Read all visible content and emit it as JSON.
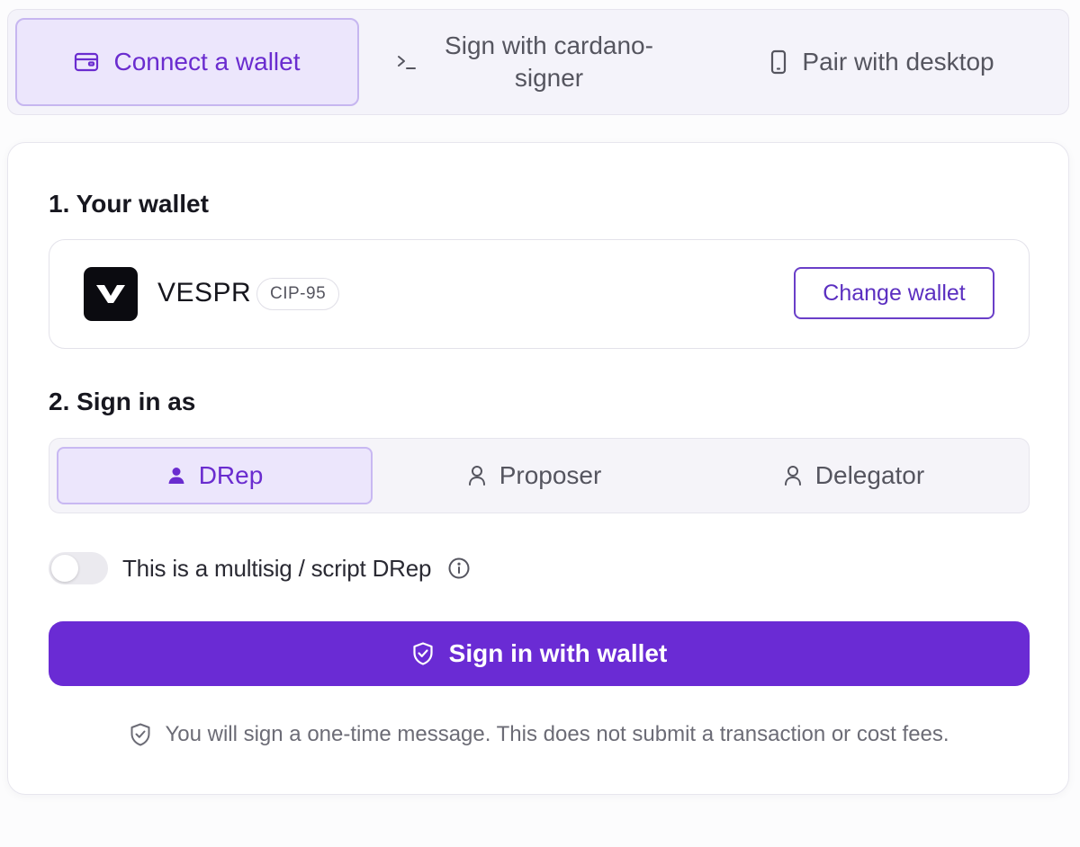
{
  "method_tabs": [
    {
      "label": "Connect a wallet",
      "icon": "wallet-icon",
      "active": true
    },
    {
      "label": "Sign with cardano-signer",
      "icon": "terminal-icon",
      "active": false
    },
    {
      "label": "Pair with desktop",
      "icon": "smartphone-icon",
      "active": false
    }
  ],
  "wallet_section": {
    "title": "1. Your wallet",
    "wallet_name": "VESPR",
    "wallet_badge": "CIP-95",
    "change_label": "Change wallet"
  },
  "signin_section": {
    "title": "2. Sign in as",
    "roles": [
      {
        "label": "DRep",
        "icon": "user-filled-icon",
        "active": true
      },
      {
        "label": "Proposer",
        "icon": "user-outline-icon",
        "active": false
      },
      {
        "label": "Delegator",
        "icon": "user-outline-icon",
        "active": false
      }
    ]
  },
  "multisig": {
    "label": "This is a multisig / script DRep",
    "enabled": false
  },
  "signin_button": {
    "label": "Sign in with wallet"
  },
  "footnote": "You will sign a one-time message. This does not submit a transaction or cost fees.",
  "colors": {
    "accent": "#6a2bd4",
    "accent_text": "#6a2ccf",
    "active_tab_bg": "#ece6fc"
  }
}
